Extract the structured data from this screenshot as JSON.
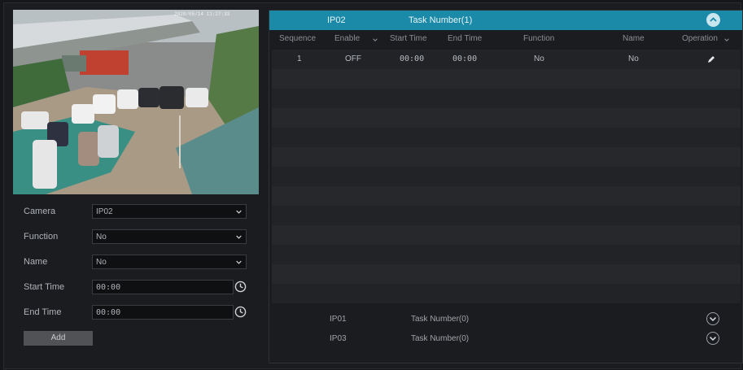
{
  "preview": {
    "timestamp": "2020/05/14 11:27:33"
  },
  "form": {
    "camera_label": "Camera",
    "camera_value": "IP02",
    "function_label": "Function",
    "function_value": "No",
    "name_label": "Name",
    "name_value": "No",
    "start_label": "Start Time",
    "start_value": "00:00",
    "end_label": "End Time",
    "end_value": "00:00",
    "add_label": "Add"
  },
  "active_group": {
    "ip": "IP02",
    "task": "Task Number(1)"
  },
  "columns": {
    "sequence": "Sequence",
    "enable": "Enable",
    "start": "Start Time",
    "end": "End Time",
    "function": "Function",
    "name": "Name",
    "operation": "Operation"
  },
  "rows": [
    {
      "sequence": "1",
      "enable": "OFF",
      "start": "00:00",
      "end": "00:00",
      "function": "No",
      "name": "No"
    }
  ],
  "other_groups": [
    {
      "ip": "IP01",
      "task": "Task Number(0)"
    },
    {
      "ip": "IP03",
      "task": "Task Number(0)"
    }
  ],
  "colors": {
    "accent": "#1a8aa8",
    "panel": "#1b1c1f"
  },
  "icons": [
    "chevron-down-icon",
    "clock-icon",
    "collapse-icon",
    "expand-icon",
    "edit-icon"
  ]
}
